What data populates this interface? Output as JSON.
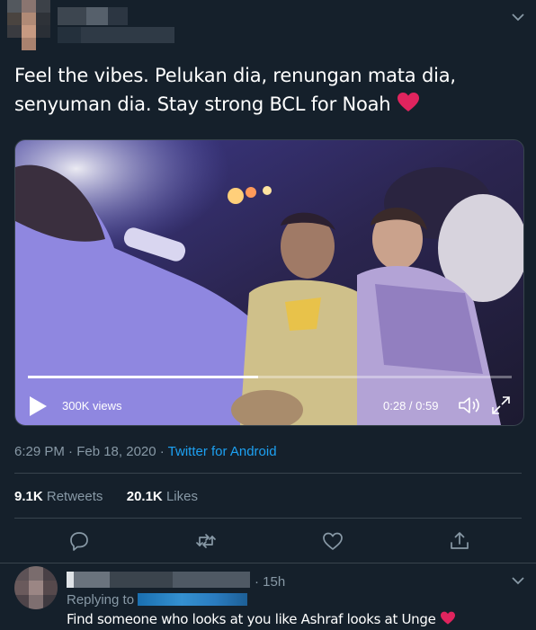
{
  "tweet": {
    "text": "Feel the vibes. Pelukan dia, renungan mata dia, senyuman dia. Stay strong BCL for Noah",
    "emoji": "heart-emoji"
  },
  "video": {
    "views": "300K views",
    "time": "0:28 / 0:59",
    "progress": 0.475
  },
  "meta": {
    "time": "6:29 PM · Feb 18, 2020",
    "separator": " · ",
    "source": "Twitter for Android"
  },
  "stats": {
    "retweets_count": "9.1K",
    "retweets_label": "Retweets",
    "likes_count": "20.1K",
    "likes_label": "Likes"
  },
  "actions": [
    "reply-icon",
    "retweet-icon",
    "like-icon",
    "share-icon"
  ],
  "reply": {
    "time": "· 15h",
    "replying_prefix": "Replying to",
    "text": "Find someone who looks at you like Ashraf looks at Unge"
  },
  "colors": {
    "background": "#15202b",
    "accent": "#1da1f2",
    "muted": "#8899a6",
    "divider": "#38444d",
    "heart": "#e0245e"
  }
}
